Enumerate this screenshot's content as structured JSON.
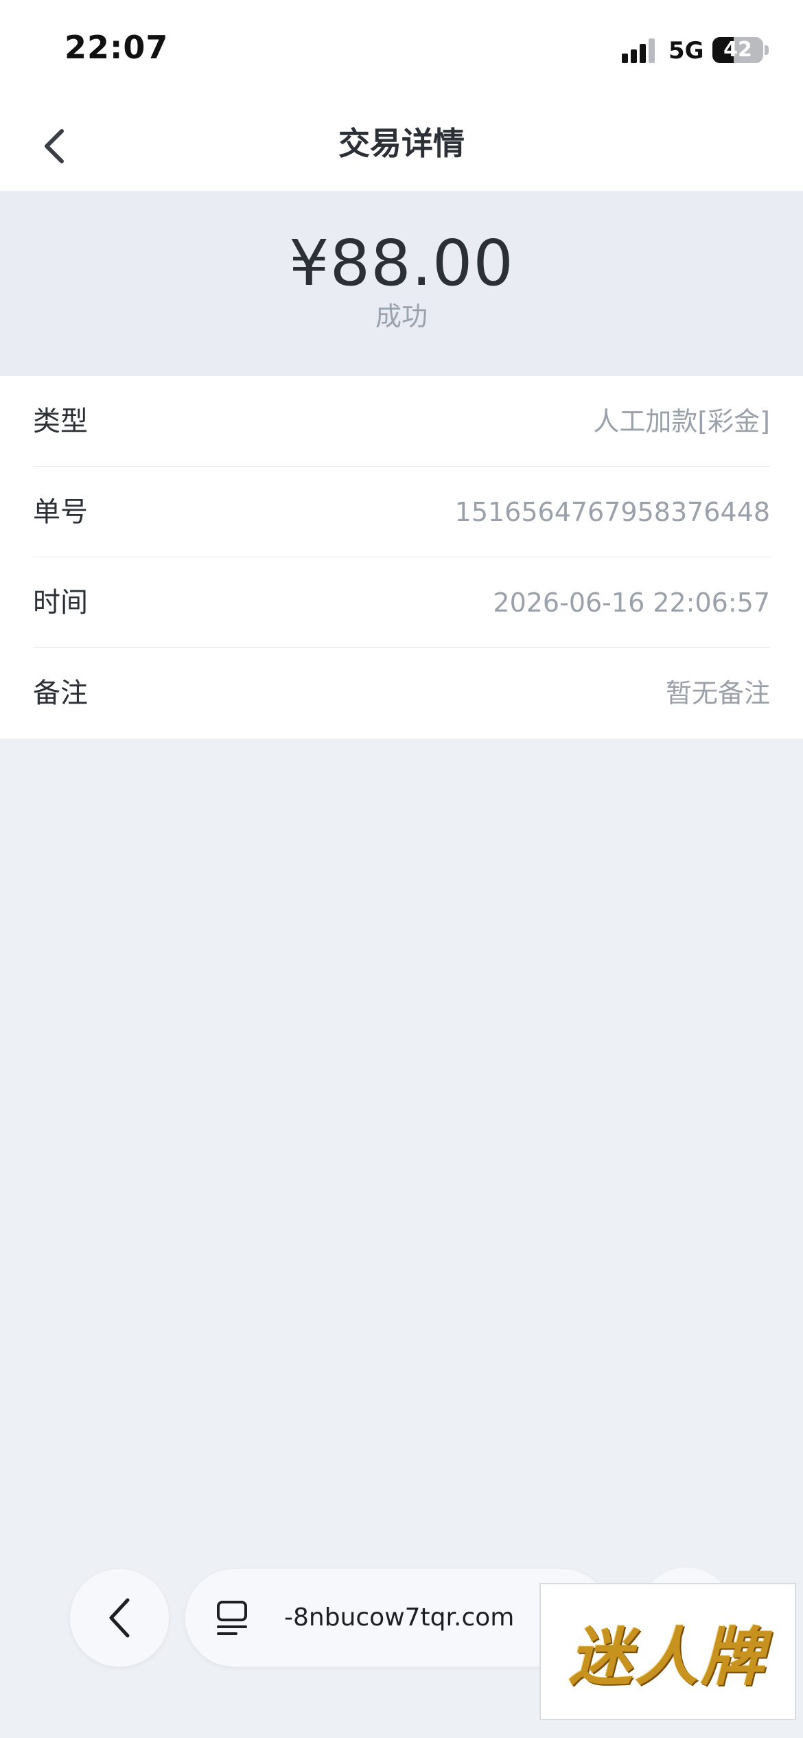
{
  "status_bar": {
    "time": "22:07",
    "network": "5G",
    "battery_level": 42
  },
  "nav": {
    "title": "交易详情",
    "back_icon": "chevron-left-icon"
  },
  "summary": {
    "amount": "¥88.00",
    "status": "成功"
  },
  "details": [
    {
      "label": "类型",
      "value": "人工加款[彩金]"
    },
    {
      "label": "单号",
      "value": "1516564767958376448"
    },
    {
      "label": "时间",
      "value": "2026-06-16 22:06:57"
    },
    {
      "label": "备注",
      "value": "暂无备注"
    }
  ],
  "browser_bar": {
    "back_icon": "chevron-left-icon",
    "tabs_icon": "tabs-icon",
    "url": "-8nbucow7tqr.com"
  },
  "logo": {
    "text": "迷人牌"
  }
}
